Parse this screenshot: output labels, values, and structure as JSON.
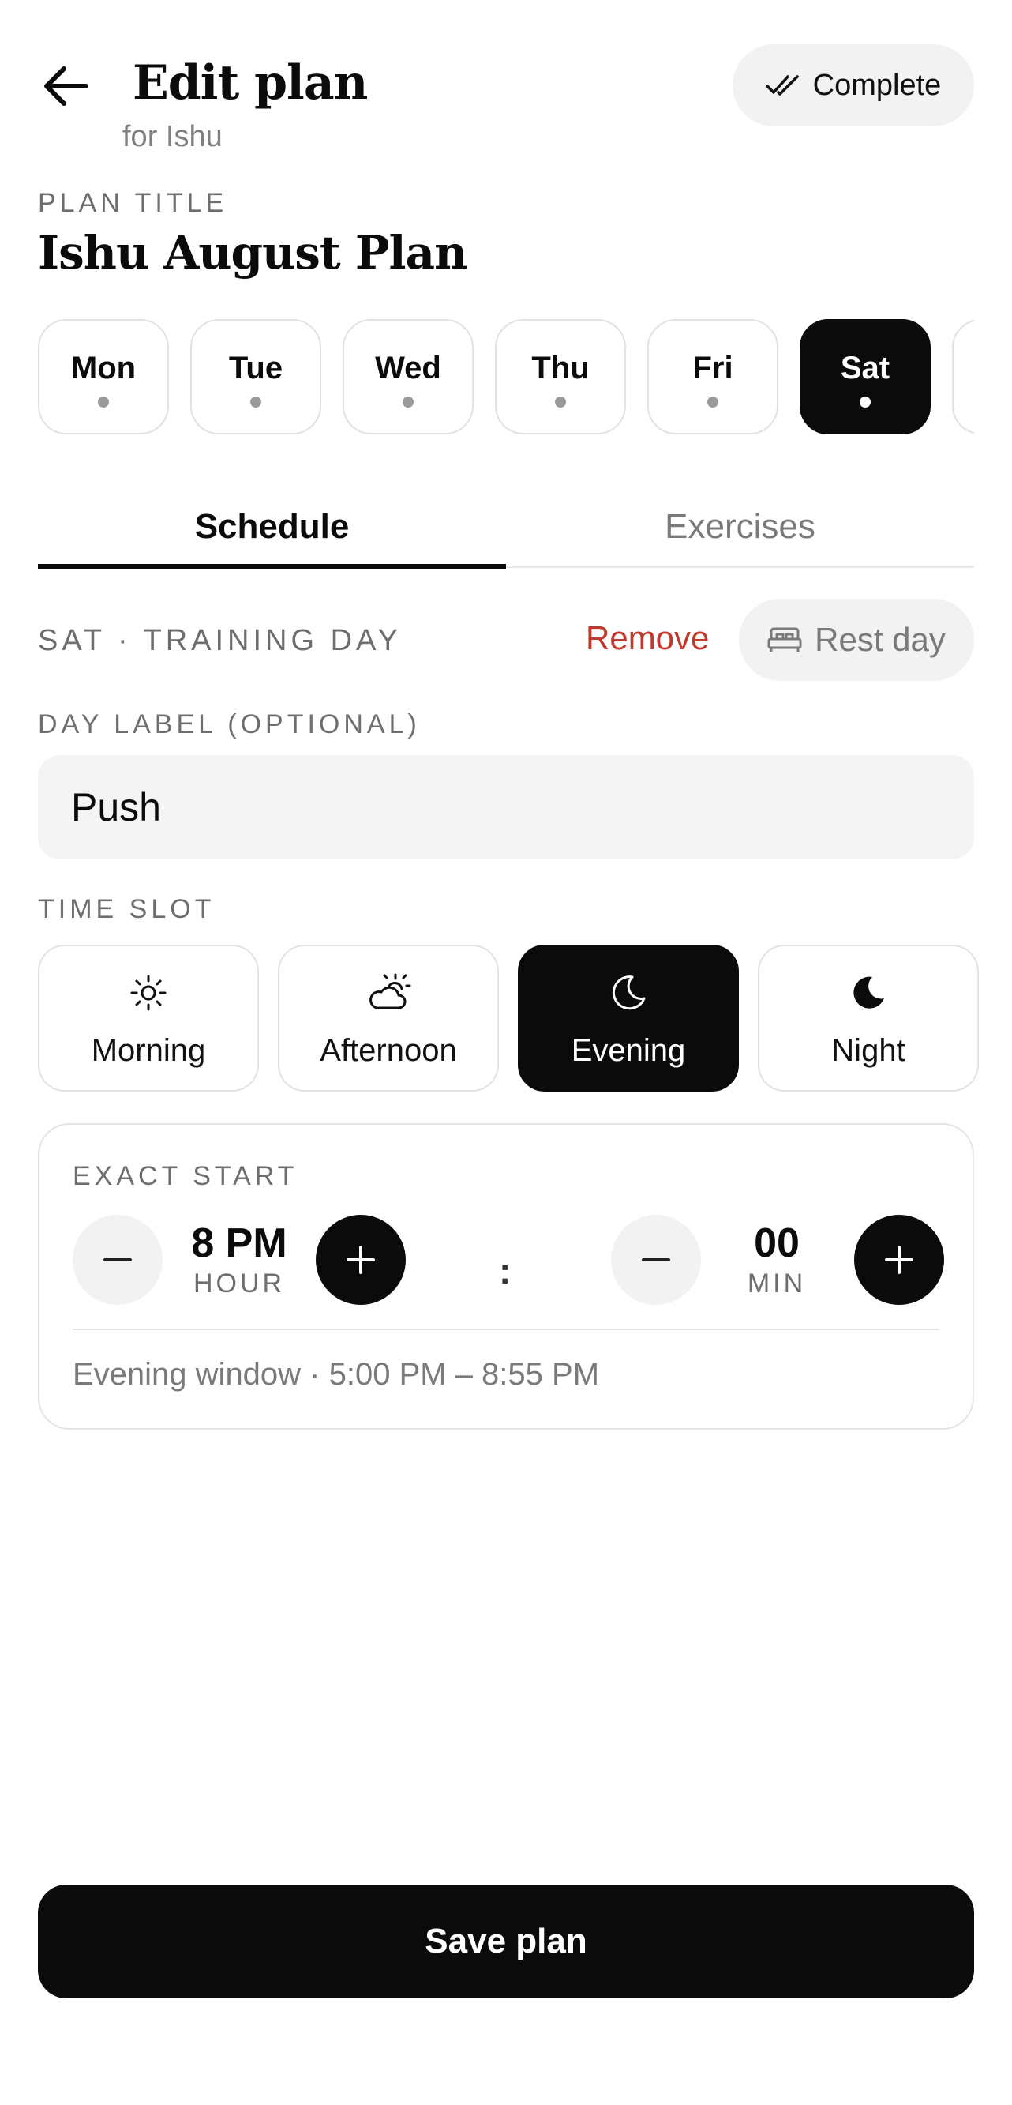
{
  "header": {
    "title": "Edit plan",
    "subtitle": "for Ishu",
    "complete_label": "Complete",
    "back_icon": "arrow-left-icon",
    "complete_icon": "double-check-icon"
  },
  "plan": {
    "title_label": "PLAN TITLE",
    "title": "Ishu August Plan"
  },
  "days": [
    {
      "label": "Mon",
      "active": false
    },
    {
      "label": "Tue",
      "active": false
    },
    {
      "label": "Wed",
      "active": false
    },
    {
      "label": "Thu",
      "active": false
    },
    {
      "label": "Fri",
      "active": false
    },
    {
      "label": "Sat",
      "active": true
    },
    {
      "label": "",
      "active": false
    }
  ],
  "tabs": {
    "schedule": "Schedule",
    "exercises": "Exercises"
  },
  "day_status": {
    "text": "SAT · TRAINING DAY",
    "remove_label": "Remove",
    "rest_day_label": "Rest day",
    "rest_icon": "bed-icon"
  },
  "day_label": {
    "title": "DAY LABEL (OPTIONAL)",
    "value": "Push"
  },
  "time_slot": {
    "title": "TIME SLOT",
    "options": [
      {
        "label": "Morning",
        "icon": "sun-icon",
        "active": false
      },
      {
        "label": "Afternoon",
        "icon": "cloud-sun-icon",
        "active": false
      },
      {
        "label": "Evening",
        "icon": "moon-outline-icon",
        "active": true
      },
      {
        "label": "Night",
        "icon": "moon-filled-icon",
        "active": false
      }
    ]
  },
  "exact_start": {
    "title": "EXACT START",
    "hour_value": "8 PM",
    "hour_unit": "HOUR",
    "separator": ":",
    "min_value": "00",
    "min_unit": "MIN",
    "window_text": "Evening window · 5:00 PM – 8:55 PM"
  },
  "save_label": "Save plan",
  "colors": {
    "accent": "#0b0b0b",
    "danger": "#c0392b",
    "muted": "#7a7a7a",
    "surface": "#f2f2f2"
  }
}
